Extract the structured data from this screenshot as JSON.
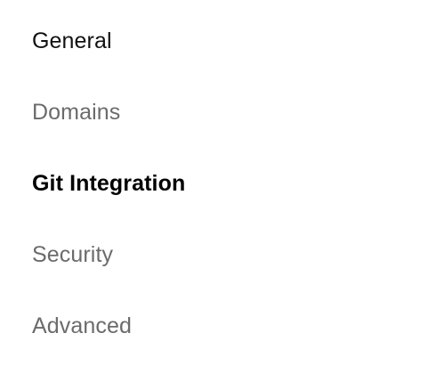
{
  "settings_nav": {
    "items": [
      {
        "label": "General",
        "state": "default"
      },
      {
        "label": "Domains",
        "state": "muted"
      },
      {
        "label": "Git Integration",
        "state": "active"
      },
      {
        "label": "Security",
        "state": "muted"
      },
      {
        "label": "Advanced",
        "state": "muted"
      }
    ]
  },
  "colors": {
    "text_default": "#111111",
    "text_muted": "#6b6b6b",
    "text_active": "#000000",
    "background": "#ffffff"
  }
}
